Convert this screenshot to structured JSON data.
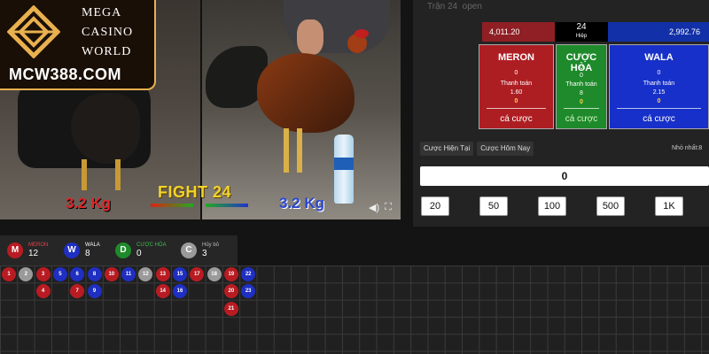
{
  "logo": {
    "mega": "MEGA",
    "casino": "CASINO",
    "world": "WORLD",
    "site": "MCW388.COM"
  },
  "video": {
    "weight_left": "3.2 Kg",
    "weight_right": "3.2 Kg",
    "fight_label": "FIGHT 24",
    "volume_icon": "volume-icon",
    "fullscreen_icon": "fullscreen-icon"
  },
  "header": {
    "round_text": "Trận 24",
    "status": "open"
  },
  "score": {
    "meron": "4,011.20",
    "round_number": "24",
    "round_label": "Hiệp",
    "wala": "2,992.76"
  },
  "bets": {
    "meron": {
      "title": "MERON",
      "line1": "0",
      "payout_label": "Thanh toán",
      "payout": "1.60",
      "amount": "0",
      "cta": "cá cược"
    },
    "hoa": {
      "title": "CƯỢC HÒA",
      "line1": "0",
      "line2": "0",
      "payout_label": "Thanh toán",
      "payout": "8",
      "amount": "0",
      "cta": "cá cược"
    },
    "wala": {
      "title": "WALA",
      "line1": "0",
      "payout_label": "Thanh toán",
      "payout": "2.15",
      "amount": "0",
      "cta": "cá cược"
    }
  },
  "tabs": [
    "Cược Hiện Tại",
    "Cược Hôm Nay"
  ],
  "min_bet_label": "Nhỏ nhất:8",
  "amount_value": "0",
  "chips": [
    "20",
    "50",
    "100",
    "500",
    "1K"
  ],
  "stats": [
    {
      "letter": "M",
      "name": "MERON",
      "value": "12",
      "color": "#b81c22",
      "name_color": "#e0444a"
    },
    {
      "letter": "W",
      "name": "WALA",
      "value": "8",
      "color": "#1f2fc2",
      "name_color": "#ffffff"
    },
    {
      "letter": "D",
      "name": "CƯỢC HÒA",
      "value": "0",
      "color": "#1e8a2b",
      "name_color": "#3fbf4f"
    },
    {
      "letter": "C",
      "name": "Hủy bỏ",
      "value": "3",
      "color": "#9a9a9a",
      "name_color": "#bbbbbb"
    }
  ],
  "history": [
    {
      "n": "1",
      "r": "M",
      "col": 0,
      "row": 0
    },
    {
      "n": "2",
      "r": "C",
      "col": 1,
      "row": 0
    },
    {
      "n": "3",
      "r": "M",
      "col": 2,
      "row": 0
    },
    {
      "n": "4",
      "r": "M",
      "col": 2,
      "row": 1
    },
    {
      "n": "5",
      "r": "W",
      "col": 3,
      "row": 0
    },
    {
      "n": "6",
      "r": "W",
      "col": 4,
      "row": 0
    },
    {
      "n": "7",
      "r": "M",
      "col": 4,
      "row": 1
    },
    {
      "n": "8",
      "r": "W",
      "col": 5,
      "row": 0
    },
    {
      "n": "9",
      "r": "W",
      "col": 5,
      "row": 1
    },
    {
      "n": "10",
      "r": "M",
      "col": 6,
      "row": 0
    },
    {
      "n": "11",
      "r": "W",
      "col": 7,
      "row": 0
    },
    {
      "n": "12",
      "r": "C",
      "col": 8,
      "row": 0
    },
    {
      "n": "13",
      "r": "M",
      "col": 9,
      "row": 0
    },
    {
      "n": "14",
      "r": "M",
      "col": 9,
      "row": 1
    },
    {
      "n": "15",
      "r": "W",
      "col": 10,
      "row": 0
    },
    {
      "n": "16",
      "r": "W",
      "col": 10,
      "row": 1
    },
    {
      "n": "17",
      "r": "M",
      "col": 11,
      "row": 0
    },
    {
      "n": "18",
      "r": "C",
      "col": 12,
      "row": 0
    },
    {
      "n": "19",
      "r": "M",
      "col": 13,
      "row": 0
    },
    {
      "n": "20",
      "r": "M",
      "col": 13,
      "row": 1
    },
    {
      "n": "21",
      "r": "M",
      "col": 13,
      "row": 2
    },
    {
      "n": "22",
      "r": "W",
      "col": 14,
      "row": 0
    },
    {
      "n": "23",
      "r": "W",
      "col": 14,
      "row": 1
    }
  ]
}
